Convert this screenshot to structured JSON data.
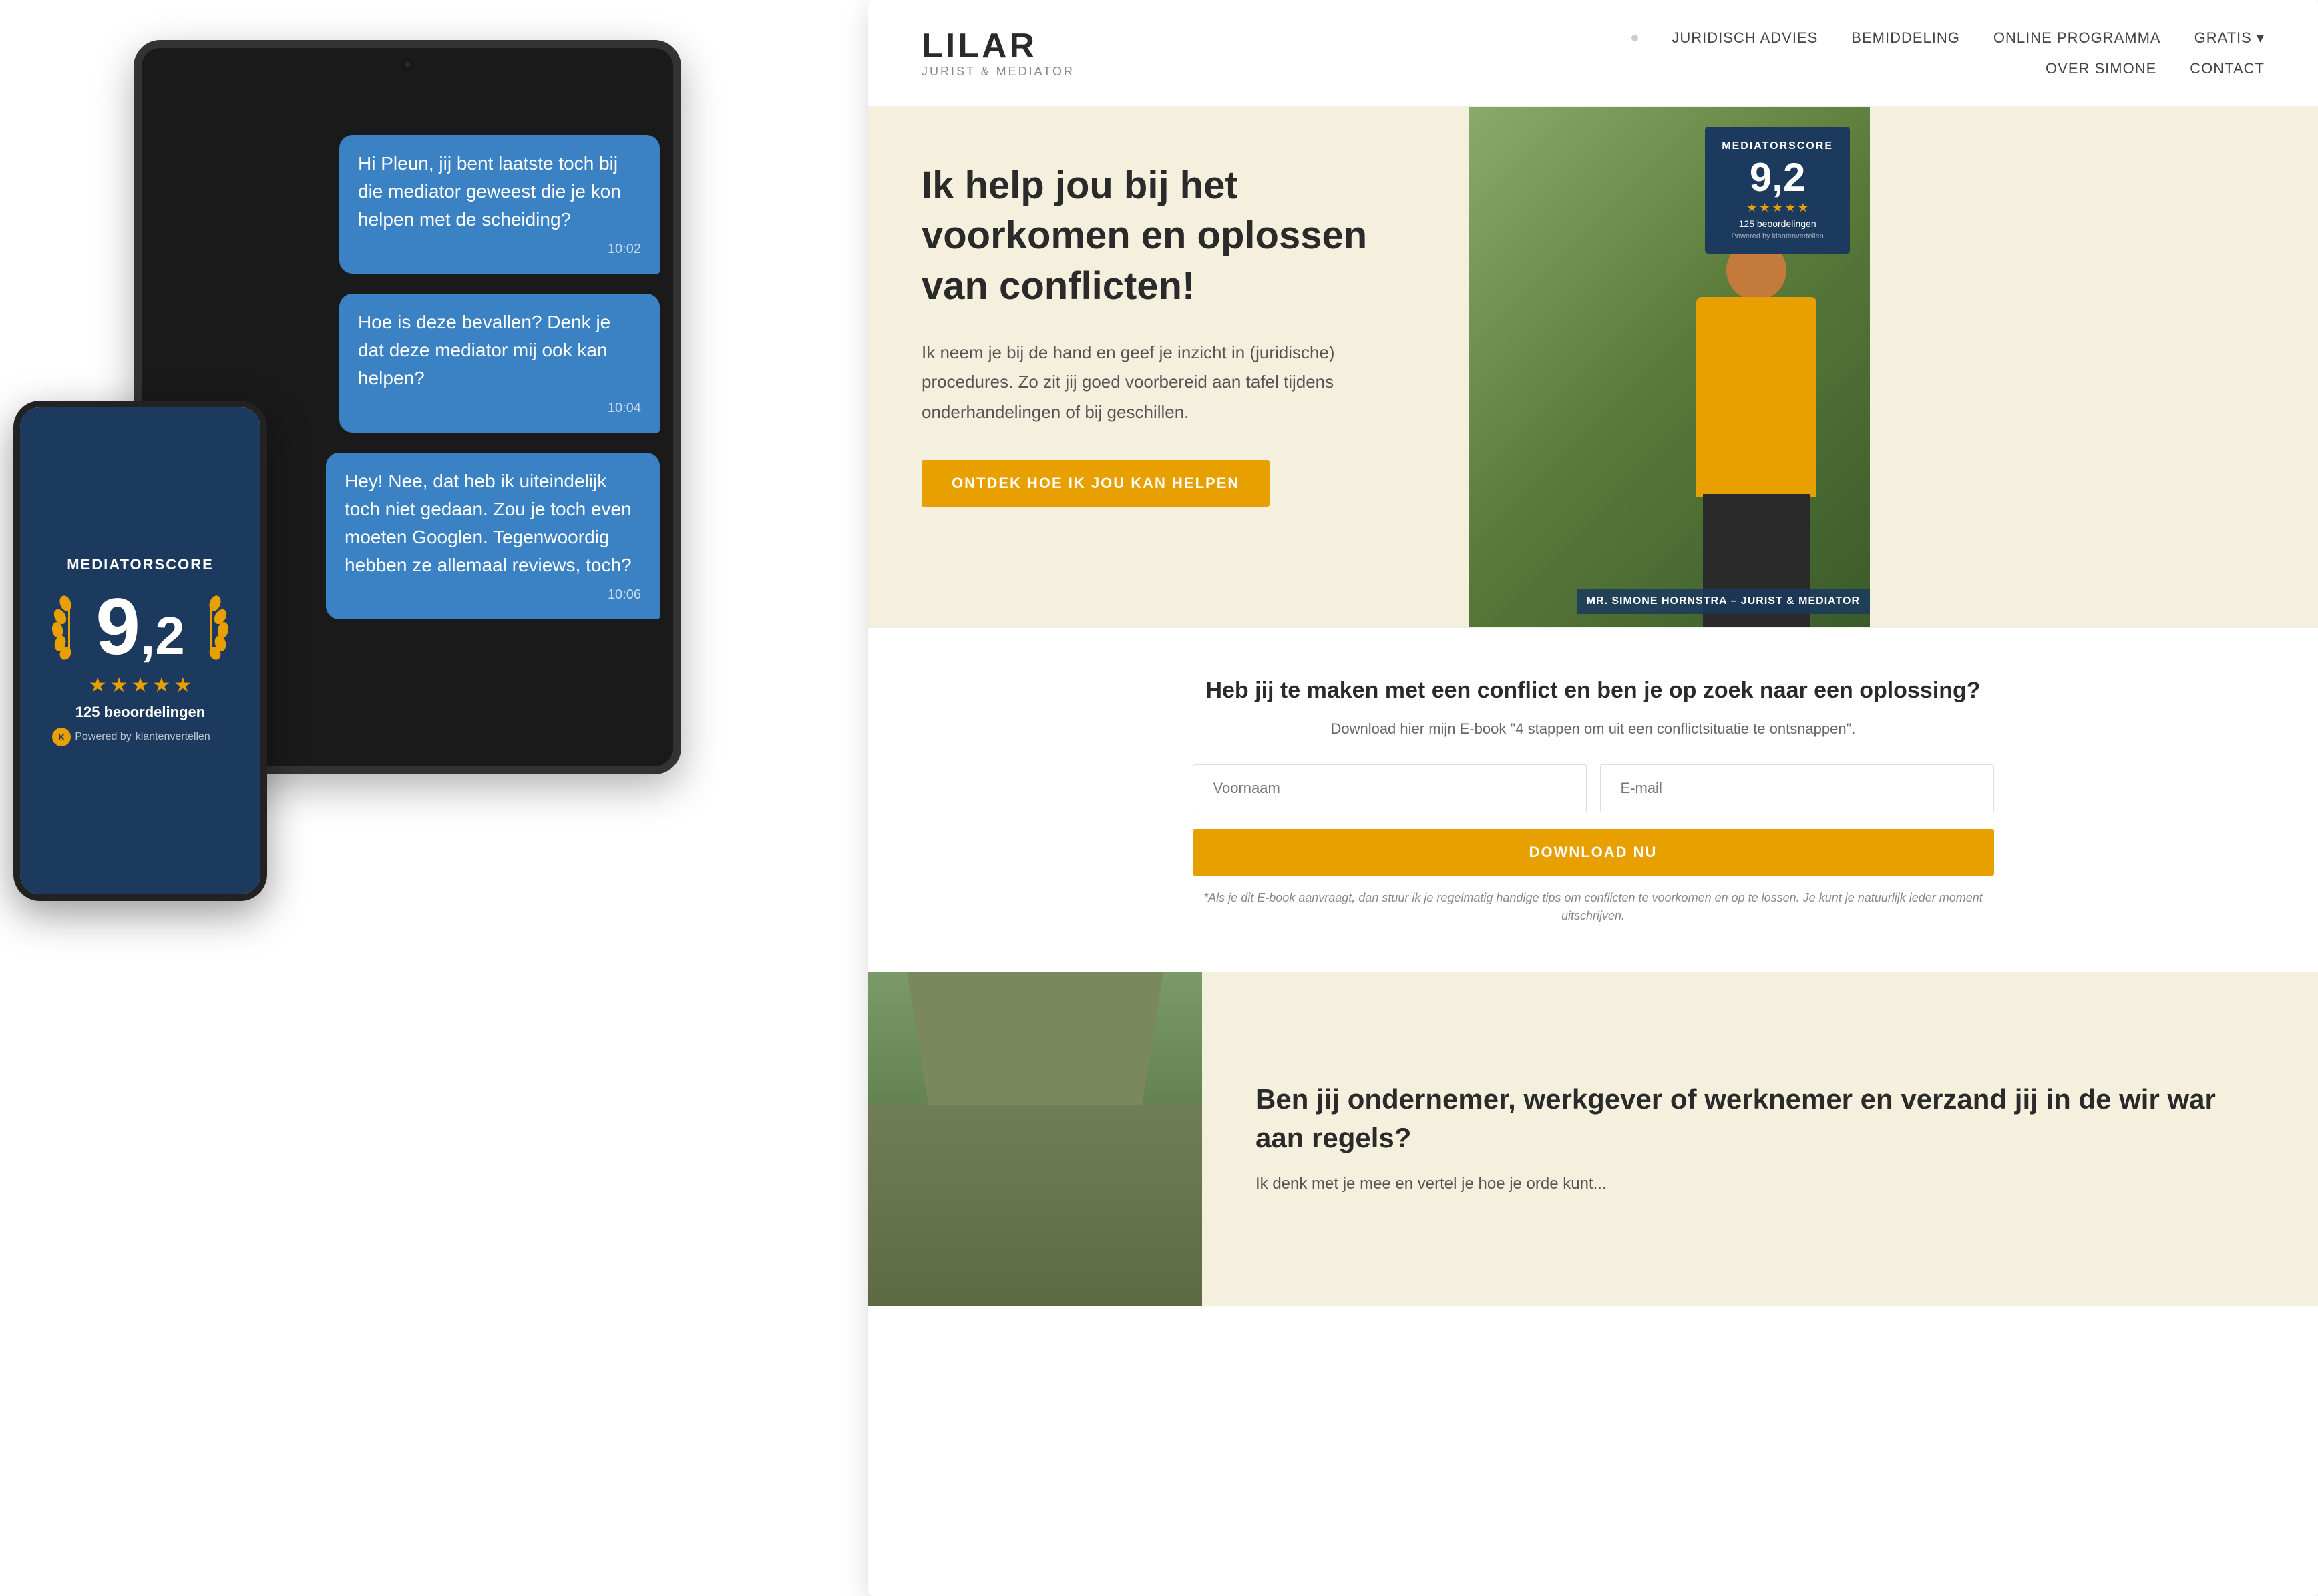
{
  "phone": {
    "score_title": "MEDIATORSCORE",
    "score": "9",
    "score_decimal": "2",
    "stars_count": 5,
    "reviews_count": "125",
    "reviews_label": "beoordelingen",
    "powered_by": "Powered by",
    "powered_company": "klantenvertellen"
  },
  "chat": {
    "messages": [
      {
        "text": "Hi Pleun, jij bent laatste toch bij die mediator geweest die je kon helpen met de scheiding?",
        "time": "10:02",
        "type": "sent"
      },
      {
        "text": "Hoe is deze bevallen? Denk je dat deze mediator mij ook kan helpen?",
        "time": "10:04",
        "type": "sent"
      },
      {
        "text": "Hey! Nee, dat heb ik uiteindelijk toch niet gedaan. Zou je toch even moeten Googlen. Tegenwoordig hebben ze allemaal reviews, toch?",
        "time": "10:06",
        "type": "received"
      }
    ]
  },
  "nav": {
    "logo_main": "LILAR",
    "logo_sub": "JURIST & MEDIATOR",
    "links_row1": [
      {
        "label": "JURIDISCH ADVIES",
        "active": false
      },
      {
        "label": "BEMIDDELING",
        "active": false
      },
      {
        "label": "ONLINE PROGRAMMA",
        "active": false
      },
      {
        "label": "GRATIS ▾",
        "active": false
      }
    ],
    "links_row2": [
      {
        "label": "OVER SIMONE",
        "active": false
      },
      {
        "label": "CONTACT",
        "active": false
      }
    ]
  },
  "hero": {
    "title": "Ik help jou bij het voorkomen en oplossen van conflicten!",
    "body": "Ik neem je bij de hand en geef je inzicht in (juridische) procedures. Zo zit jij goed voorbereid aan tafel tijdens onderhandelingen of bij geschillen.",
    "cta": "ONTDEK HOE IK JOU KAN HELPEN",
    "badge": {
      "title": "MEDIATORSCORE",
      "score": "9,2",
      "stars": 5,
      "reviews": "125 beoordelingen",
      "powered": "Powered by klantenvertellen"
    },
    "caption": "MR. SIMONE HORNSTRA – JURIST & MEDIATOR"
  },
  "ebook": {
    "title": "Heb jij te maken met een conflict en ben je op zoek naar een oplossing?",
    "subtitle": "Download hier mijn E-book \"4 stappen om uit een conflictsituatie te ontsnappen\".",
    "firstname_placeholder": "Voornaam",
    "email_placeholder": "E-mail",
    "button_label": "DOWNLOAD NU",
    "disclaimer": "*Als je dit E-book aanvraagt, dan stuur ik je regelmatig handige tips om conflicten te voorkomen en op te lossen. Je kunt je natuurlijk ieder moment uitschrijven."
  },
  "teaser": {
    "title": "Ben jij ondernemer, werkgever of werknemer en verzand jij in de wir war aan regels?",
    "body": "Ik denk met je mee en vertel je hoe je orde kunt..."
  }
}
